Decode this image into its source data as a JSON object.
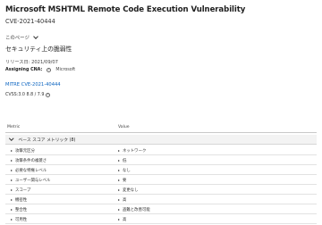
{
  "header": {
    "title": "Microsoft MSHTML Remote Code Execution Vulnerability",
    "cve_id": "CVE-2021-40444",
    "page_menu_label": "このページ",
    "section_heading": "セキュリティ上の脆弱性",
    "release_date": "リリース日: 2021/09/07"
  },
  "cna": {
    "label": "Assigning CNA:",
    "info_icon": "info-icon",
    "value": "Microsoft"
  },
  "mitre_link": "MITRE CVE-2021-40444",
  "cvss": "CVSS:3.0 8.8 / 7.9",
  "table": {
    "col_metric": "Metric",
    "col_value": "Value",
    "group_label": "ベース スコア メトリック (8)",
    "rows": [
      {
        "metric": "攻撃元区分",
        "value": "ネットワーク"
      },
      {
        "metric": "攻撃条件の複雑さ",
        "value": "低"
      },
      {
        "metric": "必要な特権レベル",
        "value": "なし"
      },
      {
        "metric": "ユーザー関与レベル",
        "value": "要"
      },
      {
        "metric": "スコープ",
        "value": "変更なし"
      },
      {
        "metric": "機密性",
        "value": "高"
      },
      {
        "metric": "整合性",
        "value": "盗難と改善可能"
      },
      {
        "metric": "可用性",
        "value": "高"
      }
    ]
  }
}
